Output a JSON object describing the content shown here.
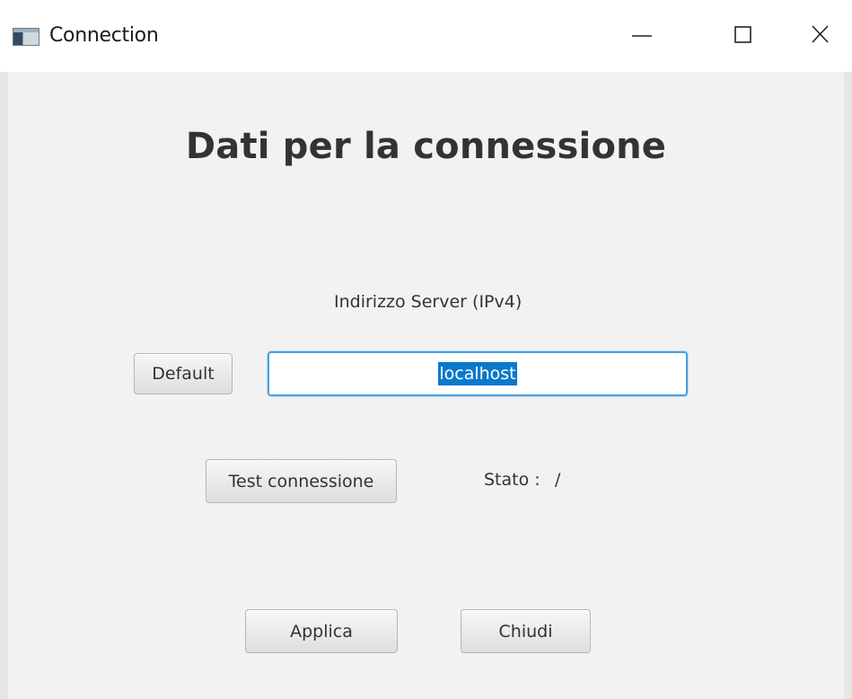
{
  "window": {
    "title": "Connection",
    "icon": "app-window-icon",
    "controls": {
      "minimize_icon": "minimize-icon",
      "maximize_icon": "maximize-icon",
      "close_icon": "close-icon"
    }
  },
  "main": {
    "heading": "Dati per la connessione",
    "address_label": "Indirizzo Server (IPv4)",
    "default_button": "Default",
    "address_value": "localhost",
    "address_selected": true,
    "test_button": "Test connessione",
    "status_label": "Stato :",
    "status_value": "/",
    "apply_button": "Applica",
    "close_button": "Chiudi"
  },
  "colors": {
    "background": "#f2f2f2",
    "focus_border": "#4aa0e0",
    "selection": "#0a79cc"
  }
}
